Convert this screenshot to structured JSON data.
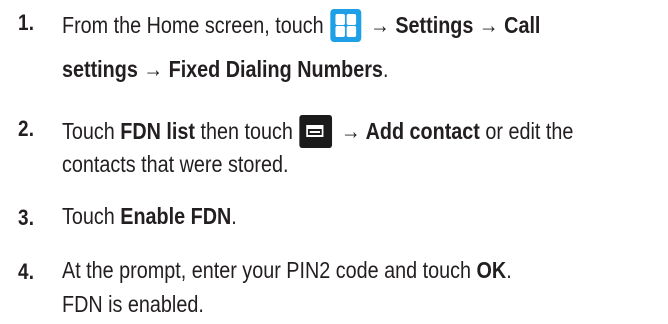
{
  "steps": [
    {
      "number": "1.",
      "line1_a": "From the Home screen, touch",
      "line1_b": "→ Settings → Call",
      "line2": "settings  → Fixed Dialing Numbers",
      "line2_end": "."
    },
    {
      "number": "2.",
      "line1_a": "Touch ",
      "line1_b": "FDN list",
      "line1_c": " then touch",
      "line1_d": "→ Add contact",
      "line1_e": " or edit the",
      "line2": "contacts that were stored."
    },
    {
      "number": "3.",
      "line1_a": "Touch ",
      "line1_b": "Enable FDN",
      "line1_c": "."
    },
    {
      "number": "4.",
      "line1_a": "At the prompt, enter your PIN2 code and touch ",
      "line1_b": "OK",
      "line1_c": ".",
      "line2": "FDN is enabled."
    }
  ],
  "icons": {
    "apps": "apps-grid-icon",
    "menu": "menu-icon"
  },
  "colors": {
    "apps_icon": "#1fa0e6",
    "menu_icon": "#1b1b1b",
    "text": "#231f20"
  }
}
